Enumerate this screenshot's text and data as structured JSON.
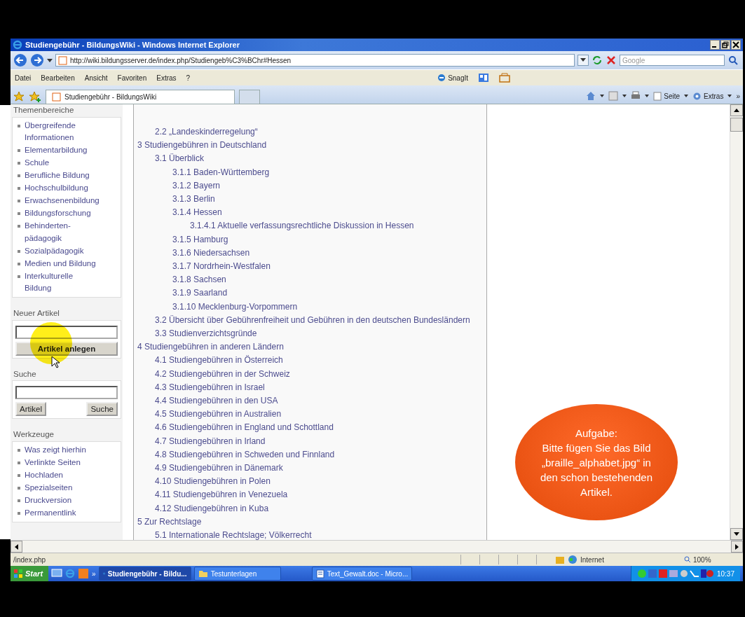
{
  "window": {
    "title": "Studiengebühr - BildungsWiki - Windows Internet Explorer"
  },
  "navigation": {
    "address": "http://wiki.bildungsserver.de/index.php/Studiengeb%C3%BChr#Hessen",
    "search_placeholder": "Google"
  },
  "menu": [
    "Datei",
    "Bearbeiten",
    "Ansicht",
    "Favoriten",
    "Extras",
    "?"
  ],
  "snagit": "SnagIt",
  "tabs": [
    {
      "label": "Studiengebühr - BildungsWiki",
      "selected": true
    }
  ],
  "command_bar": {
    "page": "Seite",
    "tools": "Extras",
    "more": "»"
  },
  "sidebar": {
    "sections": [
      {
        "kind": "links",
        "heading": "Themenbereiche",
        "items": [
          "Übergreifende Informationen",
          "Elementarbildung",
          "Schule",
          "Berufliche Bildung",
          "Hochschulbildung",
          "Erwachsenenbildung",
          "Bildungsforschung",
          "Behinderten-pädagogik",
          "Sozialpädagogik",
          "Medien und Bildung",
          "Interkulturelle Bildung"
        ]
      },
      {
        "kind": "create",
        "heading": "Neuer Artikel",
        "button": "Artikel anlegen"
      },
      {
        "kind": "search",
        "heading": "Suche",
        "buttons": [
          "Artikel",
          "Suche"
        ]
      },
      {
        "kind": "links",
        "heading": "Werkzeuge",
        "items": [
          "Was zeigt hierhin",
          "Verlinkte Seiten",
          "Hochladen",
          "Spezialseiten",
          "Druckversion",
          "Permanentlink"
        ]
      }
    ]
  },
  "toc": [
    {
      "children": [
        {
          "text": "2.2 „Landeskinderregelung“"
        }
      ]
    },
    {
      "text": "3 Studiengebühren in Deutschland",
      "children": [
        {
          "text": "3.1 Überblick",
          "children": [
            {
              "text": "3.1.1 Baden-Württemberg"
            },
            {
              "text": "3.1.2 Bayern"
            },
            {
              "text": "3.1.3 Berlin"
            },
            {
              "text": "3.1.4 Hessen",
              "children": [
                {
                  "text": "3.1.4.1 Aktuelle verfassungsrechtliche Diskussion in Hessen"
                }
              ]
            },
            {
              "text": "3.1.5 Hamburg"
            },
            {
              "text": "3.1.6 Niedersachsen"
            },
            {
              "text": "3.1.7 Nordrhein-Westfalen"
            },
            {
              "text": "3.1.8 Sachsen"
            },
            {
              "text": "3.1.9 Saarland"
            },
            {
              "text": "3.1.10 Mecklenburg-Vorpommern"
            }
          ]
        },
        {
          "text": "3.2 Übersicht über Gebührenfreiheit und Gebühren in den deutschen Bundesländern"
        },
        {
          "text": "3.3 Studienverzichtsgründe"
        }
      ]
    },
    {
      "text": "4 Studiengebühren in anderen Ländern",
      "children": [
        {
          "text": "4.1 Studiengebühren in Österreich"
        },
        {
          "text": "4.2 Studiengebühren in der Schweiz"
        },
        {
          "text": "4.3 Studiengebühren in Israel"
        },
        {
          "text": "4.4 Studiengebühren in den USA"
        },
        {
          "text": "4.5 Studiengebühren in Australien"
        },
        {
          "text": "4.6 Studiengebühren in England und Schottland"
        },
        {
          "text": "4.7 Studiengebühren in Irland"
        },
        {
          "text": "4.8 Studiengebühren in Schweden und Finnland"
        },
        {
          "text": "4.9 Studiengebühren in Dänemark"
        },
        {
          "text": "4.10 Studiengebühren in Polen"
        },
        {
          "text": "4.11 Studiengebühren in Venezuela"
        },
        {
          "text": "4.12 Studiengebühren in Kuba"
        }
      ]
    },
    {
      "text": "5 Zur Rechtslage",
      "children": [
        {
          "text": "5.1 Internationale Rechtslage; Völkerrecht"
        }
      ]
    }
  ],
  "callout": {
    "title": "Aufgabe:",
    "lines": [
      "Bitte fügen Sie das Bild",
      "„braille_alphabet.jpg“ in",
      "den schon bestehenden",
      "Artikel."
    ]
  },
  "status_bar": {
    "text": "/index.php",
    "zone": "Internet",
    "zoom": "100%"
  },
  "taskbar": {
    "start": "Start",
    "more": "»",
    "tasks": [
      {
        "label": "Studiengebühr - Bildu...",
        "kind": "browser",
        "selected": true
      },
      {
        "label": "Testunterlagen",
        "kind": "folder",
        "selected": false
      },
      {
        "label": "Text_Gewalt.doc - Micro...",
        "kind": "document",
        "selected": false
      }
    ],
    "clock": "10:37"
  }
}
